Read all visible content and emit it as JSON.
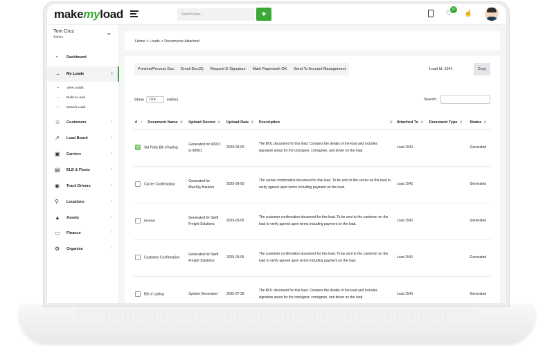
{
  "app": {
    "logo_make": "make",
    "logo_my": "my",
    "logo_load": "load",
    "search_placeholder": "Search here...",
    "add_symbol": "+",
    "notification_count": "0",
    "accent_color": "#3aa935"
  },
  "user": {
    "name": "Tom Cruz",
    "role": "Admin"
  },
  "sidebar": {
    "items": [
      {
        "label": "Dashboard",
        "icon": "dashboard-icon"
      },
      {
        "label": "My Loads",
        "icon": "truck-icon",
        "active": true
      },
      {
        "label": "Customers",
        "icon": "users-icon"
      },
      {
        "label": "Load Board",
        "icon": "chart-icon"
      },
      {
        "label": "Carriers",
        "icon": "carrier-icon"
      },
      {
        "label": "ELD & Fleets",
        "icon": "fleet-icon"
      },
      {
        "label": "Track Drivers",
        "icon": "location-pin-icon"
      },
      {
        "label": "Locations",
        "icon": "map-pin-icon"
      },
      {
        "label": "Assets",
        "icon": "bag-icon"
      },
      {
        "label": "Finance",
        "icon": "wallet-icon"
      },
      {
        "label": "Organise",
        "icon": "settings-icon"
      }
    ],
    "subitems": [
      "View Loads",
      "Build a Load",
      "Search Load"
    ]
  },
  "breadcrumb": "Home > Loads > Documents Attached",
  "toolbar": {
    "buttons": [
      "Preview/Process Doc",
      "Email Doc(S)",
      "Request E-Signature",
      "Mark Paperwork OK",
      "Send To Account Management"
    ],
    "load_id": "Load Id: 1541",
    "copy": "Copy"
  },
  "table_controls": {
    "show": "Show",
    "entries_value": "10",
    "entries": "entries",
    "search_label": "Search:"
  },
  "table": {
    "headers": [
      "#",
      "Document Name",
      "Upload Source",
      "Upload Date",
      "Description",
      "Attached To",
      "Document Type",
      "Status"
    ],
    "rows": [
      {
        "checked": true,
        "name": "3rd Party Bill of lading",
        "source": "Generated for 90922 to 90901",
        "date": "2025-09-05",
        "description": "The BOL document for this load. Contains the details of the load and includes signature areas for the consignor, consignee, and driver on the load.",
        "attached": "Load 1541",
        "type": "",
        "status": "Generated"
      },
      {
        "checked": false,
        "name": "Carrier Confirmation",
        "source": "Generated for BlueSky Haulers",
        "date": "2025-09-05",
        "description": "The carrier confirmation document for this load. To be sent to the carrier on the load to verify agreed upon terms including payment on the load.",
        "attached": "Load 1541",
        "type": "",
        "status": "Generated"
      },
      {
        "checked": false,
        "name": "Invoice",
        "source": "Generated for Swift Freight Solutions",
        "date": "2025-09-05",
        "description": "The customer confirmation document for this load. To be sent to the customer on the load to verify agreed upon terms including payment on the load.",
        "attached": "Load 1541",
        "type": "",
        "status": "Generated"
      },
      {
        "checked": false,
        "name": "Customer Confirmation",
        "source": "Generated for Swift Freight Solutions",
        "date": "2025-09-05",
        "description": "The customer confirmation document for this load. To be sent to the customer on the load to verify agreed upon terms including payment on the load.",
        "attached": "Load 1541",
        "type": "",
        "status": "Generated"
      },
      {
        "checked": false,
        "name": "Bill of Lading",
        "source": "System Generated",
        "date": "2025-07-38",
        "description": "The BOL document for this load. Contains the details of the load and includes signature areas for the consignor, consignee, and driver on the load.",
        "attached": "Load 1541",
        "type": "",
        "status": "Generated"
      }
    ]
  }
}
